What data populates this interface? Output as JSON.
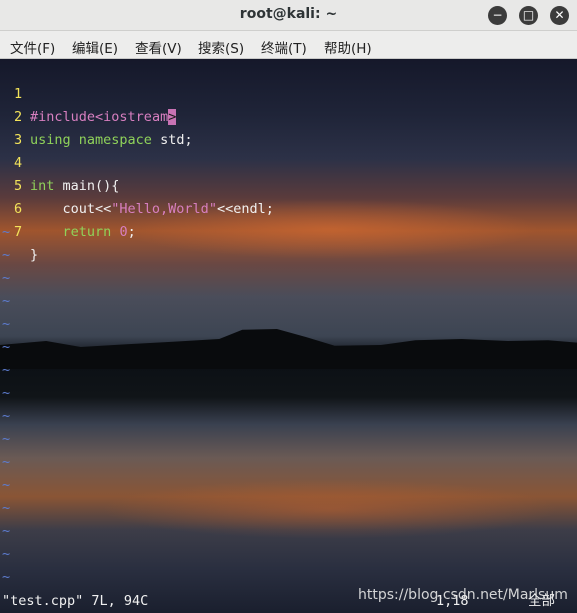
{
  "window": {
    "title": "root@kali: ~",
    "buttons": {
      "minimize": "−",
      "maximize": "□",
      "close": "✕"
    }
  },
  "menu": [
    {
      "label": "文件(F)"
    },
    {
      "label": "编辑(E)"
    },
    {
      "label": "查看(V)"
    },
    {
      "label": "搜索(S)"
    },
    {
      "label": "终端(T)"
    },
    {
      "label": "帮助(H)"
    }
  ],
  "editor": {
    "lines": [
      {
        "num": "1",
        "pre": "#include",
        "angle_open": "<",
        "angle_mid": "iostream",
        "cursor": ">"
      },
      {
        "num": "2",
        "kw1": "using",
        "sp1": " ",
        "kw2": "namespace",
        "rest": " std;"
      },
      {
        "num": "3"
      },
      {
        "num": "4",
        "kw1": "int",
        "rest": " main(){"
      },
      {
        "num": "5",
        "indent": "    cout<<",
        "str": "\"Hello,World\"",
        "rest": "<<endl;"
      },
      {
        "num": "6",
        "indent": "    ",
        "kw1": "return",
        "rest1": " ",
        "num_lit": "0",
        "rest": ";"
      },
      {
        "num": "7",
        "rest": "}"
      }
    ],
    "tilde": "~"
  },
  "status": {
    "file_info": "\"test.cpp\" 7L, 94C",
    "position": "1,18",
    "scroll": "全部"
  },
  "watermark": "https://blog.csdn.net/Marlsum"
}
